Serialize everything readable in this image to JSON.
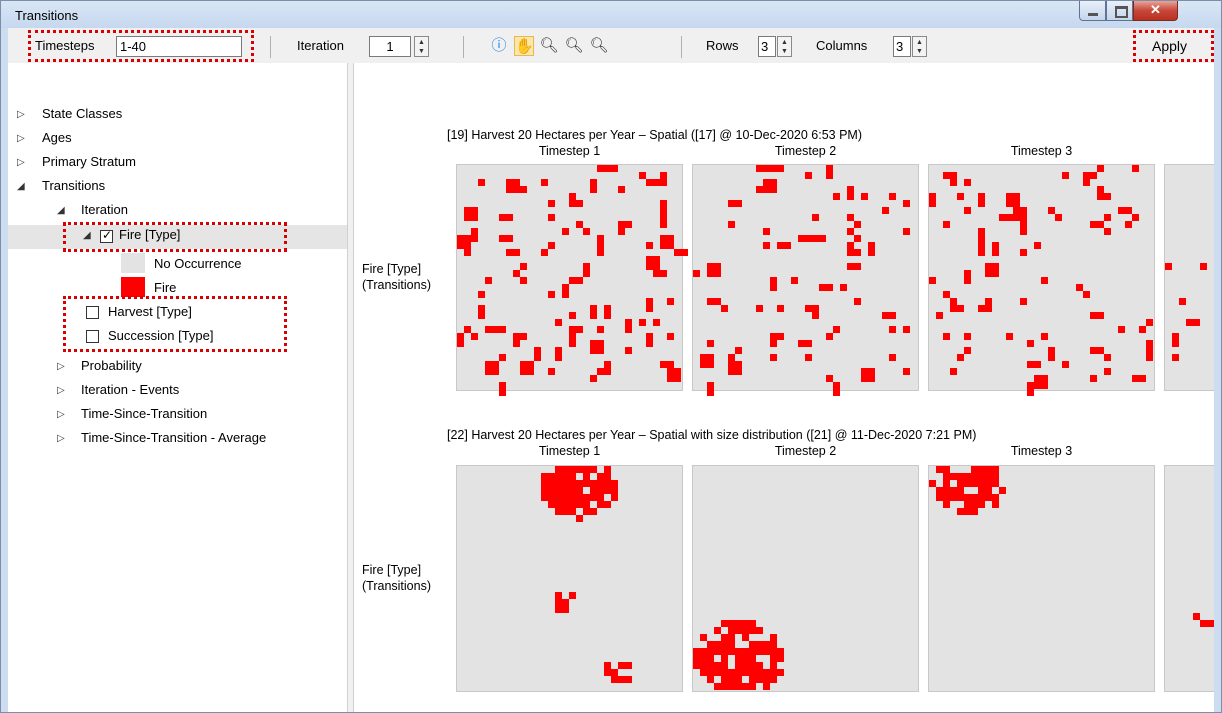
{
  "window": {
    "title": "Transitions"
  },
  "toolbar": {
    "timesteps_label": "Timesteps",
    "timesteps_value": "1-40",
    "iteration_label": "Iteration",
    "iteration_value": "1",
    "rows_label": "Rows",
    "rows_value": "3",
    "columns_label": "Columns",
    "columns_value": "3",
    "apply_label": "Apply",
    "tools": [
      "info-icon",
      "pan-hand-icon",
      "zoom-out-icon",
      "zoom-in-icon",
      "zoom-reset-icon"
    ]
  },
  "tree": {
    "state_classes": "State Classes",
    "ages": "Ages",
    "primary_stratum": "Primary Stratum",
    "transitions": "Transitions",
    "iteration": "Iteration",
    "fire_type": "Fire [Type]",
    "legend_no_occurrence": "No Occurrence",
    "legend_fire": "Fire",
    "harvest_type": "Harvest [Type]",
    "succession_type": "Succession [Type]",
    "probability": "Probability",
    "iteration_events": "Iteration - Events",
    "time_since_transition": "Time-Since-Transition",
    "time_since_transition_avg": "Time-Since-Transition - Average",
    "fire_checked": true,
    "harvest_checked": false,
    "succession_checked": false
  },
  "colors": {
    "fire": "#ff0000",
    "no_occurrence": "#e3e3e3",
    "highlight": "#d80000"
  },
  "maps": [
    {
      "title": "[19] Harvest 20 Hectares per Year – Spatial ([17] @ 10-Dec-2020 6:53 PM)",
      "row_label_1": "Fire [Type]",
      "row_label_2": "(Transitions)",
      "timesteps": [
        "Timestep 1",
        "Timestep 2",
        "Timestep 3"
      ]
    },
    {
      "title": "[22] Harvest 20 Hectares per Year – Spatial with size distribution ([21] @ 11-Dec-2020 7:21 PM)",
      "row_label_1": "Fire [Type]",
      "row_label_2": "(Transitions)",
      "timesteps": [
        "Timestep 1",
        "Timestep 2",
        "Timestep 3"
      ]
    }
  ]
}
